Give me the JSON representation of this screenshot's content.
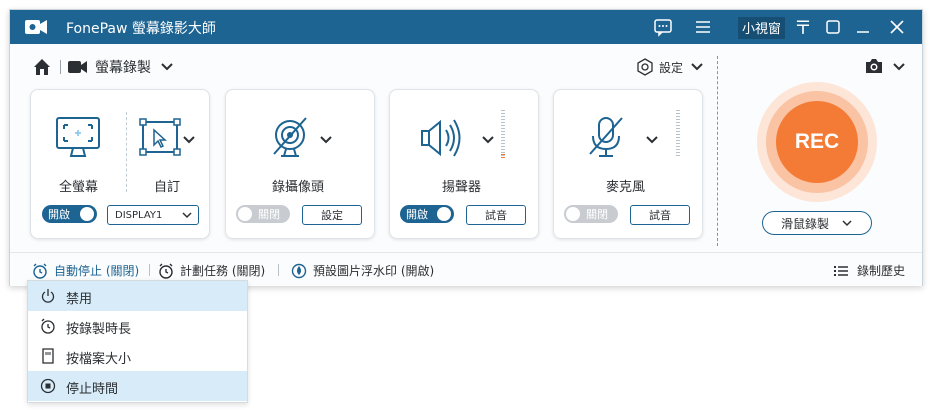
{
  "app": {
    "title": "FonePaw 螢幕錄影大師",
    "mini_window": "小視窗",
    "pin_glyph": "〒"
  },
  "toolbar": {
    "mode_label": "螢幕錄製",
    "settings_label": "設定"
  },
  "screen_card": {
    "full_label": "全螢幕",
    "custom_label": "自訂",
    "toggle_label": "開啟",
    "toggle_on": true,
    "display_value": "DISPLAY1"
  },
  "webcam_card": {
    "label": "錄攝像頭",
    "toggle_label": "關閉",
    "toggle_on": false,
    "button_label": "設定"
  },
  "speaker_card": {
    "label": "揚聲器",
    "toggle_label": "開啟",
    "toggle_on": true,
    "button_label": "試音"
  },
  "mic_card": {
    "label": "麥克風",
    "toggle_label": "關閉",
    "toggle_on": false,
    "button_label": "試音"
  },
  "rec": {
    "label": "REC",
    "mouse_record_label": "滑鼠錄製",
    "color": "#f47b35"
  },
  "bottom_bar": {
    "auto_stop": "自動停止 (關閉)",
    "schedule": "計劃任務 (關閉)",
    "watermark": "預設圖片浮水印 (開啟)",
    "history": "錄制歷史"
  },
  "dropdown": {
    "items": [
      {
        "label": "禁用",
        "icon": "power-icon",
        "highlighted": true
      },
      {
        "label": "按錄製時長",
        "icon": "clock-icon",
        "highlighted": false
      },
      {
        "label": "按檔案大小",
        "icon": "file-icon",
        "highlighted": false
      },
      {
        "label": "停止時間",
        "icon": "stop-icon",
        "highlighted": true
      }
    ]
  },
  "colors": {
    "titlebar": "#1e6492",
    "accent": "#1e6492",
    "highlight": "#d7ecf8",
    "rec": "#f47b35"
  }
}
